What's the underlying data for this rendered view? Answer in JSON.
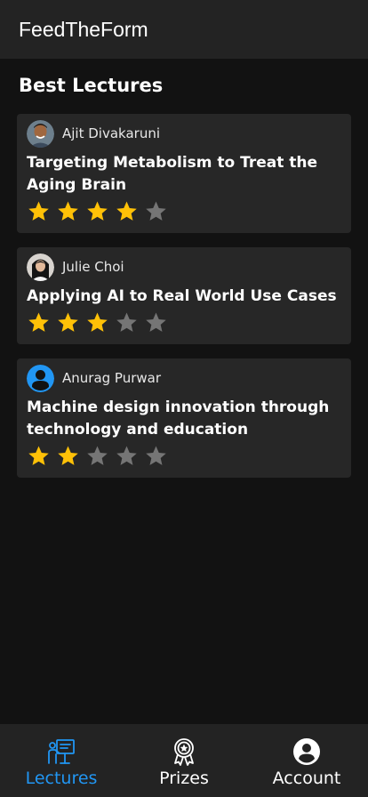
{
  "app": {
    "title": "FeedTheForm"
  },
  "section": {
    "title": "Best Lectures"
  },
  "colors": {
    "star_filled": "#FFC107",
    "star_empty": "#757575",
    "active_nav": "#2196F3"
  },
  "lectures": [
    {
      "author": "Ajit Divakaruni",
      "title": "Targeting Metabolism to Treat the Aging Brain",
      "rating": 4,
      "max_rating": 5,
      "avatar": "photo"
    },
    {
      "author": "Julie Choi",
      "title": "Applying AI to Real World Use Cases",
      "rating": 3,
      "max_rating": 5,
      "avatar": "photo"
    },
    {
      "author": "Anurag Purwar",
      "title": "Machine design innovation through technology and education",
      "rating": 2,
      "max_rating": 5,
      "avatar": "default-person-icon"
    }
  ],
  "nav": {
    "items": [
      {
        "label": "Lectures",
        "icon": "lecture-presenter-icon",
        "active": true
      },
      {
        "label": "Prizes",
        "icon": "award-badge-icon",
        "active": false
      },
      {
        "label": "Account",
        "icon": "account-circle-icon",
        "active": false
      }
    ]
  }
}
